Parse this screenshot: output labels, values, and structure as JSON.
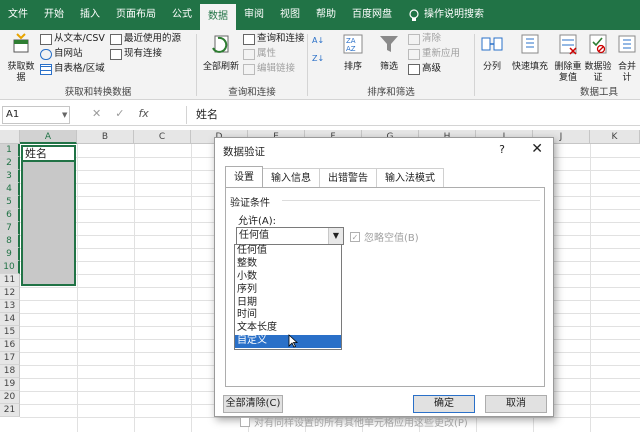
{
  "tabs": [
    "文件",
    "开始",
    "插入",
    "页面布局",
    "公式",
    "数据",
    "审阅",
    "视图",
    "帮助",
    "百度网盘"
  ],
  "tell_me": "操作说明搜索",
  "ribbon": {
    "get_data": "获取数据",
    "from_text": "从文本/CSV",
    "from_web": "自网站",
    "from_table": "自表格/区域",
    "recent": "最近使用的源",
    "existing": "现有连接",
    "group1": "获取和转换数据",
    "refresh_all": "全部刷新",
    "queries": "查询和连接",
    "properties": "属性",
    "edit_links": "编辑链接",
    "group2": "查询和连接",
    "sort": "排序",
    "filter": "筛选",
    "clear": "清除",
    "reapply": "重新应用",
    "advanced": "高级",
    "group3": "排序和筛选",
    "split": "分列",
    "flash": "快速填充",
    "remove_dup": "删除重复值",
    "validation": "数据验证",
    "merge": "合并计",
    "group4": "数据工具"
  },
  "formula_bar": {
    "name_box": "A1",
    "fx": "fx",
    "formula": "姓名"
  },
  "grid": {
    "columns": [
      "A",
      "B",
      "C",
      "D",
      "E",
      "F",
      "G",
      "H",
      "I",
      "J",
      "K"
    ],
    "rows": [
      "1",
      "2",
      "3",
      "4",
      "5",
      "6",
      "7",
      "8",
      "9",
      "10",
      "11",
      "12",
      "13",
      "14",
      "15",
      "16",
      "17",
      "18",
      "19",
      "20",
      "21"
    ],
    "a1_value": "姓名"
  },
  "dialog": {
    "title": "数据验证",
    "help": "?",
    "close": "✕",
    "tabs": [
      "设置",
      "输入信息",
      "出错警告",
      "输入法模式"
    ],
    "criteria": "验证条件",
    "allow_label": "允许(A):",
    "allow_value": "任何值",
    "ignore_blank": "忽略空值(B)",
    "options": [
      "任何值",
      "整数",
      "小数",
      "序列",
      "日期",
      "时间",
      "文本长度",
      "自定义"
    ],
    "selected_option": "自定义",
    "apply_all": "对有同样设置的所有其他单元格应用这些更改(P)",
    "clear_all": "全部清除(C)",
    "ok": "确定",
    "cancel": "取消"
  }
}
